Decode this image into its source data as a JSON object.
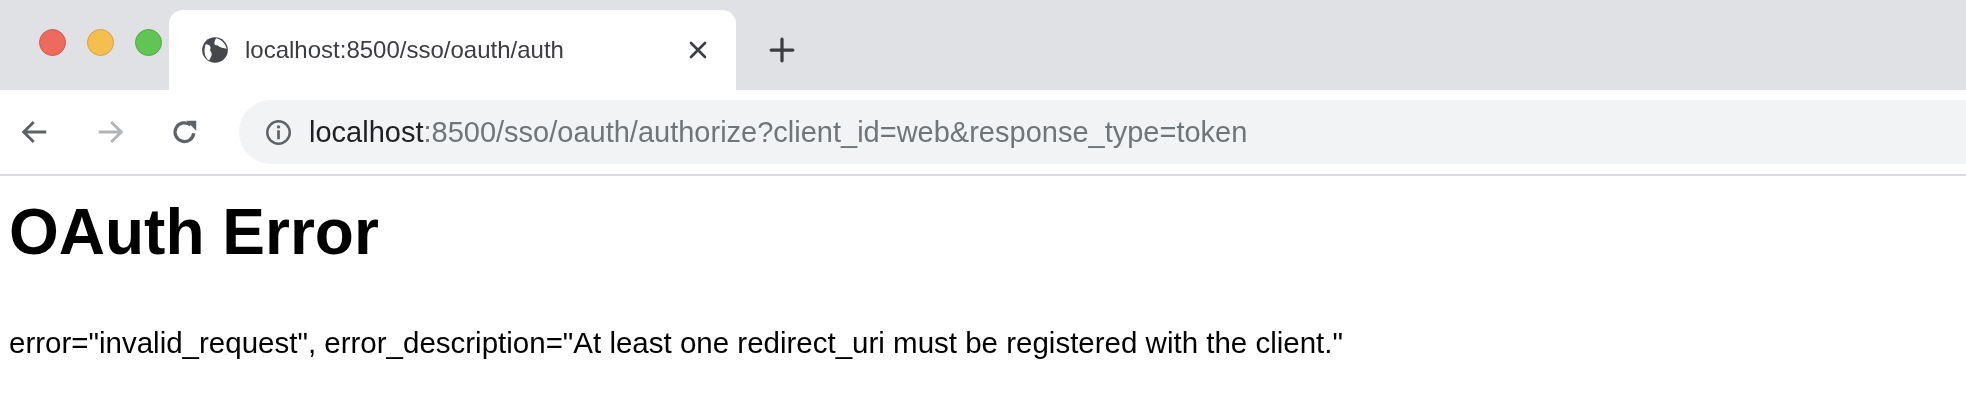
{
  "tab": {
    "title": "localhost:8500/sso/oauth/auth",
    "selected": true
  },
  "address": {
    "host": "localhost",
    "rest": ":8500/sso/oauth/authorize?client_id=web&response_type=token"
  },
  "nav": {
    "back_disabled": false,
    "forward_disabled": true
  },
  "page": {
    "heading": "OAuth Error",
    "message": "error=\"invalid_request\", error_description=\"At least one redirect_uri must be registered with the client.\""
  }
}
